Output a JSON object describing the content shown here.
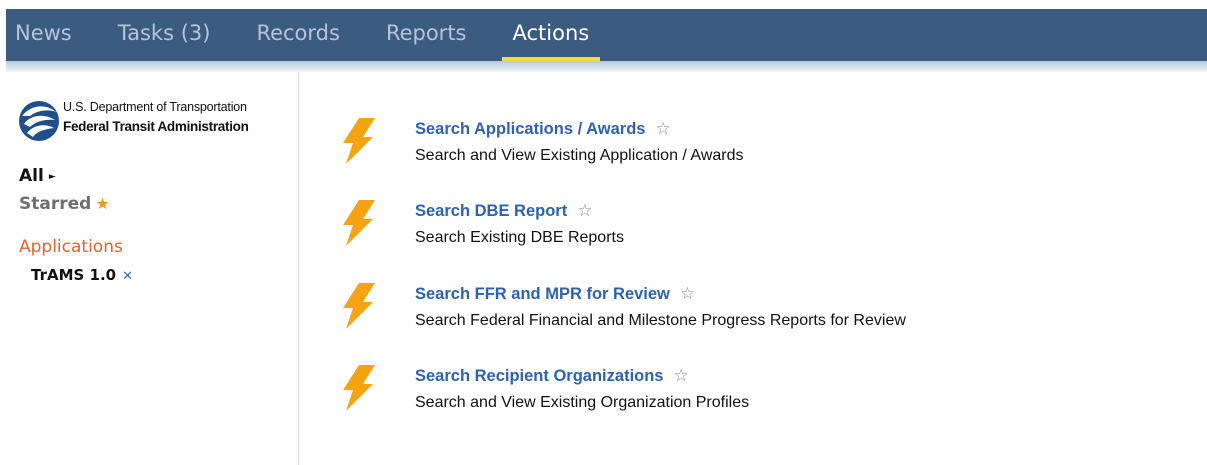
{
  "top_nav": {
    "tabs": [
      {
        "label": "News"
      },
      {
        "label": "Tasks (3)"
      },
      {
        "label": "Records"
      },
      {
        "label": "Reports"
      },
      {
        "label": "Actions",
        "active": true
      }
    ]
  },
  "sidebar": {
    "logo": {
      "line1": "U.S. Department of Transportation",
      "line2": "Federal Transit Administration"
    },
    "all_label": "All",
    "starred_label": "Starred",
    "applications_heading": "Applications",
    "applied_filter": "TrAMS 1.0"
  },
  "icons": {
    "action": "lightning-bolt-icon",
    "favorite": "star-outline-icon",
    "starred": "star-icon",
    "expand": "triangle-right-icon",
    "remove": "close-icon"
  },
  "colors": {
    "header_bg": "#3b5b80",
    "active_tab_underline": "#f4dd3a",
    "link_blue": "#2f62ad",
    "applications_orange": "#e2632b",
    "bolt_orange": "#f6a312"
  },
  "actions": [
    {
      "title": "Search Applications / Awards",
      "description": "Search and View Existing Application / Awards"
    },
    {
      "title": "Search DBE Report",
      "description": "Search Existing DBE Reports"
    },
    {
      "title": "Search FFR and MPR for Review",
      "description": "Search Federal Financial and Milestone Progress Reports for Review"
    },
    {
      "title": "Search Recipient Organizations",
      "description": "Search and View Existing Organization Profiles"
    }
  ]
}
